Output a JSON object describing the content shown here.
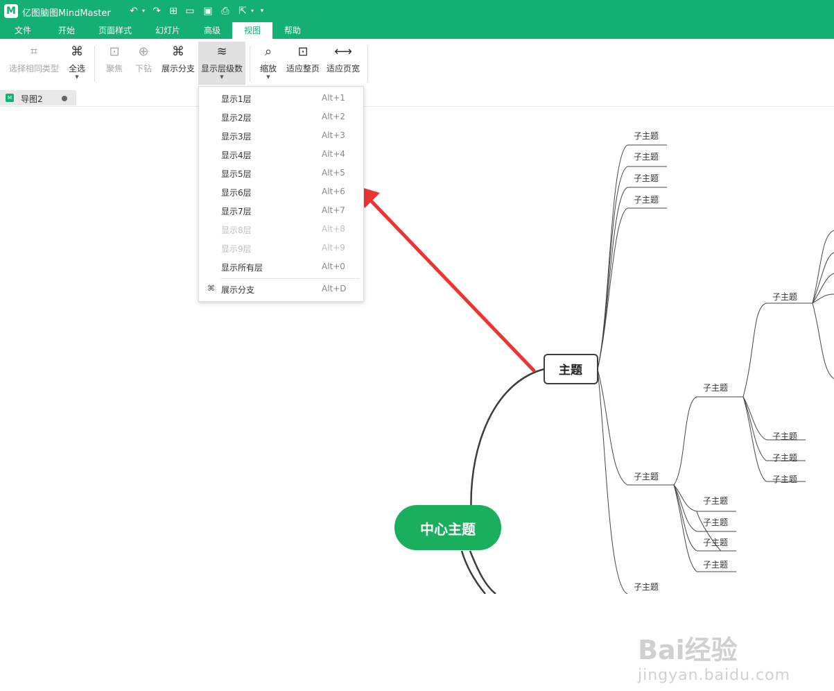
{
  "app": {
    "title": "亿图脑图MindMaster"
  },
  "quick_access": [
    "undo",
    "redo",
    "new",
    "open",
    "save",
    "print",
    "export",
    "more"
  ],
  "menu": {
    "tabs": [
      "文件",
      "开始",
      "页面样式",
      "幻灯片",
      "高级",
      "视图",
      "帮助"
    ],
    "active": "视图"
  },
  "ribbon": {
    "select_same_type": "选择相同类型",
    "select_all": "全选",
    "focus": "聚焦",
    "drill_down": "下钻",
    "show_branch": "展示分支",
    "show_levels": "显示层级数",
    "zoom": "缩放",
    "fit_page": "适应整页",
    "fit_width": "适应页宽"
  },
  "document_tab": {
    "name": "导图2",
    "file_icon": "xmind-file-icon"
  },
  "dropdown": {
    "items": [
      {
        "label": "显示1层",
        "shortcut": "Alt+1",
        "enabled": true
      },
      {
        "label": "显示2层",
        "shortcut": "Alt+2",
        "enabled": true
      },
      {
        "label": "显示3层",
        "shortcut": "Alt+3",
        "enabled": true
      },
      {
        "label": "显示4层",
        "shortcut": "Alt+4",
        "enabled": true
      },
      {
        "label": "显示5层",
        "shortcut": "Alt+5",
        "enabled": true
      },
      {
        "label": "显示6层",
        "shortcut": "Alt+6",
        "enabled": true
      },
      {
        "label": "显示7层",
        "shortcut": "Alt+7",
        "enabled": true
      },
      {
        "label": "显示8层",
        "shortcut": "Alt+8",
        "enabled": false
      },
      {
        "label": "显示9层",
        "shortcut": "Alt+9",
        "enabled": false
      },
      {
        "label": "显示所有层",
        "shortcut": "Alt+0",
        "enabled": true
      }
    ],
    "branch_item": {
      "label": "展示分支",
      "shortcut": "Alt+D"
    }
  },
  "mindmap": {
    "central": "中心主题",
    "main": "主题",
    "subtopic": "子主题"
  },
  "watermark": {
    "brand": "Bai经验",
    "url": "jingyan.baidu.com"
  },
  "colors": {
    "brand_green": "#14af72",
    "central_fill": "#1aaf5d",
    "annotation_red": "#ee3333"
  }
}
